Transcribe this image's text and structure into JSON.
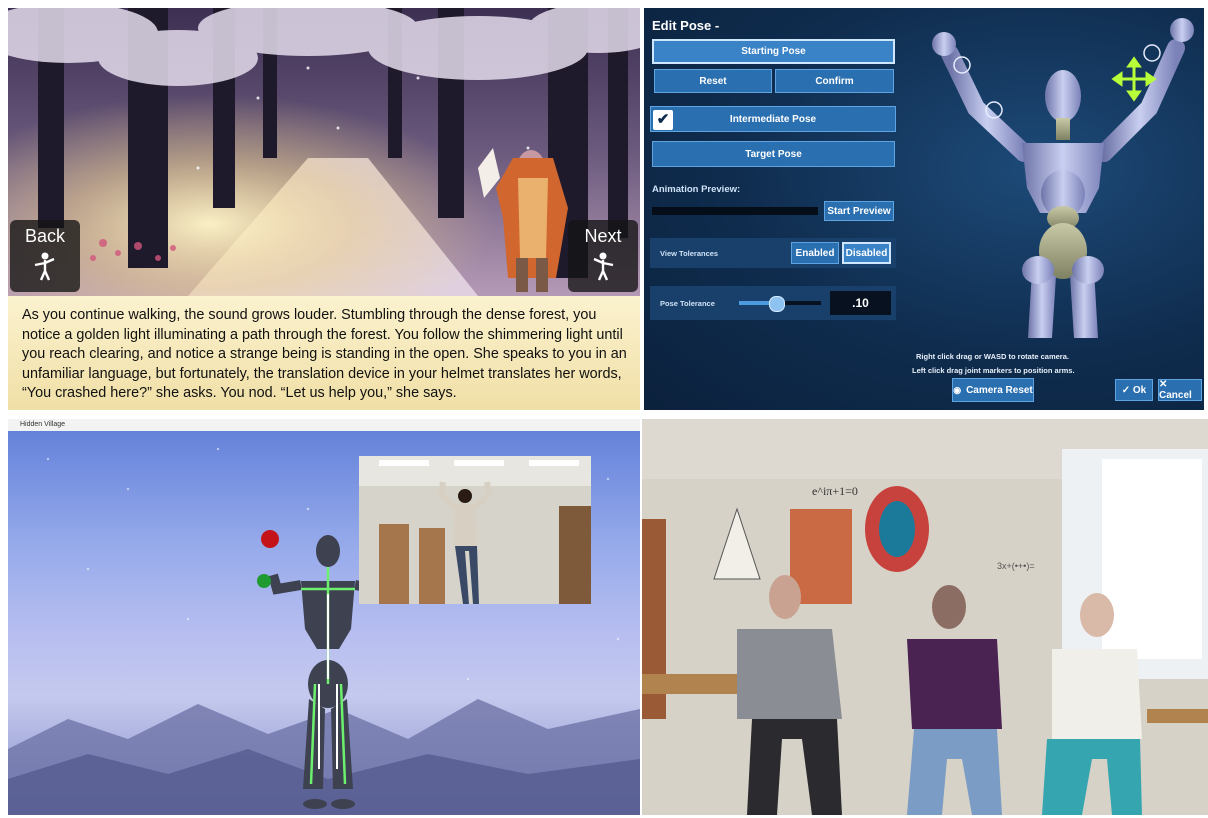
{
  "story_scene": {
    "back_label": "Back",
    "next_label": "Next",
    "text": "As you continue walking, the sound grows louder.  Stumbling through the dense forest, you notice a golden light illuminating a path through the forest. You follow the shimmering light until you reach clearing, and notice a strange being is standing in the open.  She speaks to you in an unfamiliar language, but fortunately, the translation device in your helmet translates her words, “You crashed here?” she asks. You nod. “Let us help you,” she says."
  },
  "edit_pose": {
    "title": "Edit Pose -",
    "starting_pose": "Starting Pose",
    "reset": "Reset",
    "confirm": "Confirm",
    "intermediate_pose": "Intermediate Pose",
    "intermediate_checked": true,
    "check_mark": "✔",
    "target_pose": "Target Pose",
    "animation_preview_label": "Animation Preview:",
    "start_preview": "Start Preview",
    "view_tolerances_label": "View Tolerances",
    "enabled": "Enabled",
    "disabled": "Disabled",
    "pose_tolerance_label": "Pose Tolerance",
    "pose_tolerance_slider_level": 0.45,
    "pose_tolerance_value": ".10",
    "hint_camera": "Right click drag or WASD to rotate camera.",
    "hint_arms": "Left click drag joint markers to position arms.",
    "camera_reset": "Camera Reset",
    "ok": "✓ Ok",
    "cancel": "✕ Cancel",
    "accent": "#2a6fb0",
    "background": "#0f2c4e"
  },
  "hidden_village": {
    "window_title": "Hidden Village"
  },
  "classroom": {
    "board_text": "e^iπ+1=0",
    "whiteboard_text": "3x+(•+•)="
  }
}
